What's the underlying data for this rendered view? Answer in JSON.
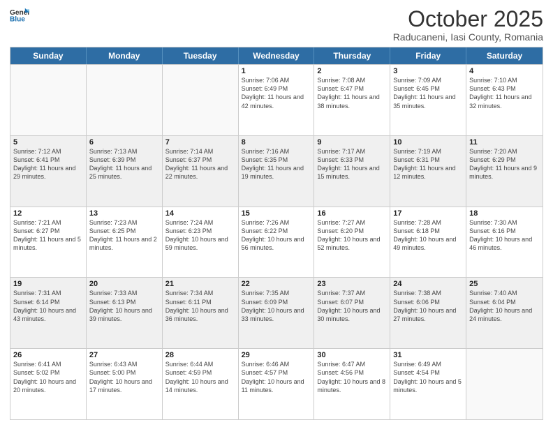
{
  "header": {
    "logo": {
      "general": "General",
      "blue": "Blue"
    },
    "month": "October 2025",
    "location": "Raducaneni, Iasi County, Romania"
  },
  "weekdays": [
    "Sunday",
    "Monday",
    "Tuesday",
    "Wednesday",
    "Thursday",
    "Friday",
    "Saturday"
  ],
  "rows": [
    [
      {
        "day": "",
        "info": ""
      },
      {
        "day": "",
        "info": ""
      },
      {
        "day": "",
        "info": ""
      },
      {
        "day": "1",
        "info": "Sunrise: 7:06 AM\nSunset: 6:49 PM\nDaylight: 11 hours and 42 minutes."
      },
      {
        "day": "2",
        "info": "Sunrise: 7:08 AM\nSunset: 6:47 PM\nDaylight: 11 hours and 38 minutes."
      },
      {
        "day": "3",
        "info": "Sunrise: 7:09 AM\nSunset: 6:45 PM\nDaylight: 11 hours and 35 minutes."
      },
      {
        "day": "4",
        "info": "Sunrise: 7:10 AM\nSunset: 6:43 PM\nDaylight: 11 hours and 32 minutes."
      }
    ],
    [
      {
        "day": "5",
        "info": "Sunrise: 7:12 AM\nSunset: 6:41 PM\nDaylight: 11 hours and 29 minutes."
      },
      {
        "day": "6",
        "info": "Sunrise: 7:13 AM\nSunset: 6:39 PM\nDaylight: 11 hours and 25 minutes."
      },
      {
        "day": "7",
        "info": "Sunrise: 7:14 AM\nSunset: 6:37 PM\nDaylight: 11 hours and 22 minutes."
      },
      {
        "day": "8",
        "info": "Sunrise: 7:16 AM\nSunset: 6:35 PM\nDaylight: 11 hours and 19 minutes."
      },
      {
        "day": "9",
        "info": "Sunrise: 7:17 AM\nSunset: 6:33 PM\nDaylight: 11 hours and 15 minutes."
      },
      {
        "day": "10",
        "info": "Sunrise: 7:19 AM\nSunset: 6:31 PM\nDaylight: 11 hours and 12 minutes."
      },
      {
        "day": "11",
        "info": "Sunrise: 7:20 AM\nSunset: 6:29 PM\nDaylight: 11 hours and 9 minutes."
      }
    ],
    [
      {
        "day": "12",
        "info": "Sunrise: 7:21 AM\nSunset: 6:27 PM\nDaylight: 11 hours and 5 minutes."
      },
      {
        "day": "13",
        "info": "Sunrise: 7:23 AM\nSunset: 6:25 PM\nDaylight: 11 hours and 2 minutes."
      },
      {
        "day": "14",
        "info": "Sunrise: 7:24 AM\nSunset: 6:23 PM\nDaylight: 10 hours and 59 minutes."
      },
      {
        "day": "15",
        "info": "Sunrise: 7:26 AM\nSunset: 6:22 PM\nDaylight: 10 hours and 56 minutes."
      },
      {
        "day": "16",
        "info": "Sunrise: 7:27 AM\nSunset: 6:20 PM\nDaylight: 10 hours and 52 minutes."
      },
      {
        "day": "17",
        "info": "Sunrise: 7:28 AM\nSunset: 6:18 PM\nDaylight: 10 hours and 49 minutes."
      },
      {
        "day": "18",
        "info": "Sunrise: 7:30 AM\nSunset: 6:16 PM\nDaylight: 10 hours and 46 minutes."
      }
    ],
    [
      {
        "day": "19",
        "info": "Sunrise: 7:31 AM\nSunset: 6:14 PM\nDaylight: 10 hours and 43 minutes."
      },
      {
        "day": "20",
        "info": "Sunrise: 7:33 AM\nSunset: 6:13 PM\nDaylight: 10 hours and 39 minutes."
      },
      {
        "day": "21",
        "info": "Sunrise: 7:34 AM\nSunset: 6:11 PM\nDaylight: 10 hours and 36 minutes."
      },
      {
        "day": "22",
        "info": "Sunrise: 7:35 AM\nSunset: 6:09 PM\nDaylight: 10 hours and 33 minutes."
      },
      {
        "day": "23",
        "info": "Sunrise: 7:37 AM\nSunset: 6:07 PM\nDaylight: 10 hours and 30 minutes."
      },
      {
        "day": "24",
        "info": "Sunrise: 7:38 AM\nSunset: 6:06 PM\nDaylight: 10 hours and 27 minutes."
      },
      {
        "day": "25",
        "info": "Sunrise: 7:40 AM\nSunset: 6:04 PM\nDaylight: 10 hours and 24 minutes."
      }
    ],
    [
      {
        "day": "26",
        "info": "Sunrise: 6:41 AM\nSunset: 5:02 PM\nDaylight: 10 hours and 20 minutes."
      },
      {
        "day": "27",
        "info": "Sunrise: 6:43 AM\nSunset: 5:00 PM\nDaylight: 10 hours and 17 minutes."
      },
      {
        "day": "28",
        "info": "Sunrise: 6:44 AM\nSunset: 4:59 PM\nDaylight: 10 hours and 14 minutes."
      },
      {
        "day": "29",
        "info": "Sunrise: 6:46 AM\nSunset: 4:57 PM\nDaylight: 10 hours and 11 minutes."
      },
      {
        "day": "30",
        "info": "Sunrise: 6:47 AM\nSunset: 4:56 PM\nDaylight: 10 hours and 8 minutes."
      },
      {
        "day": "31",
        "info": "Sunrise: 6:49 AM\nSunset: 4:54 PM\nDaylight: 10 hours and 5 minutes."
      },
      {
        "day": "",
        "info": ""
      }
    ]
  ]
}
